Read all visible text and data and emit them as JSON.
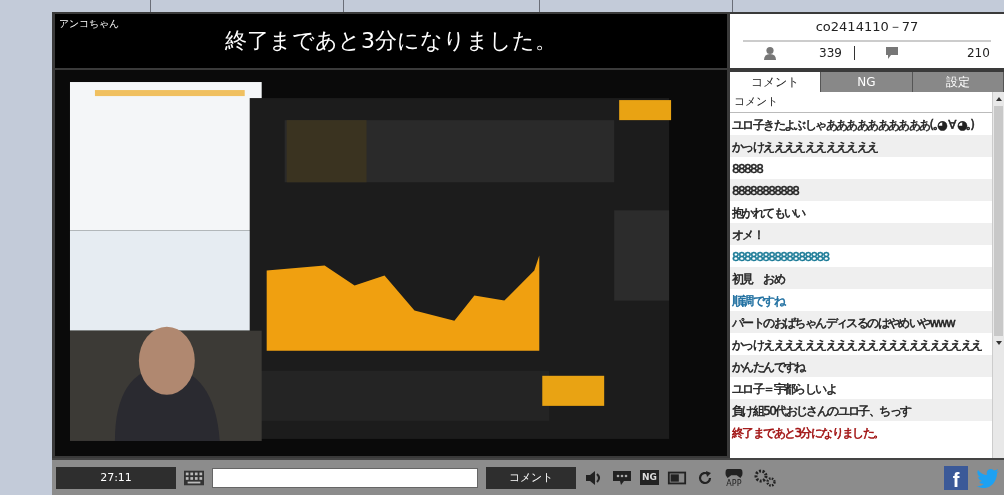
{
  "player": {
    "caster": "アンコちゃん",
    "announcement": "終了まであと3分になりました。"
  },
  "panel": {
    "community": "co2414110－77",
    "viewers": "339",
    "comments": "210"
  },
  "tabs": [
    {
      "label": "コメント",
      "selected": true
    },
    {
      "label": "NG",
      "selected": false
    },
    {
      "label": "設定",
      "selected": false
    }
  ],
  "comment_list": {
    "header": "コメント",
    "rows": [
      {
        "text": "ユロ子きたよぶしゃああああああああああ(｡◕ ∀ ◕｡)",
        "color": "#222222"
      },
      {
        "text": "かっけえええええええええええ",
        "color": "#222222"
      },
      {
        "text": "88888",
        "color": "#222222"
      },
      {
        "text": "88888888888",
        "color": "#222222"
      },
      {
        "text": "抱かれてもいい",
        "color": "#222222"
      },
      {
        "text": "オメ！",
        "color": "#222222"
      },
      {
        "text": "8888888888888888",
        "color": "#1a7a96"
      },
      {
        "text": "初見　おめ",
        "color": "#222222"
      },
      {
        "text": "順調ですね",
        "color": "#1f6fa0"
      },
      {
        "text": "パートのおばちゃんディスるのはやめいやwww",
        "color": "#222222"
      },
      {
        "text": "かっけえええええええええええええええええええええ",
        "color": "#222222"
      },
      {
        "text": "かんたんですね",
        "color": "#222222"
      },
      {
        "text": "ユロ子＝宇都らしいよ",
        "color": "#222222"
      },
      {
        "text": "負け組50代おじさんのユロ子、ちっす",
        "color": "#222222"
      },
      {
        "text": "終了まであと3分になりました。",
        "color": "#a01010"
      }
    ]
  },
  "bottom_bar": {
    "time": "27:11",
    "submit": "コメント",
    "ng_label": "NG",
    "app_label": "APP",
    "facebook": "f"
  }
}
